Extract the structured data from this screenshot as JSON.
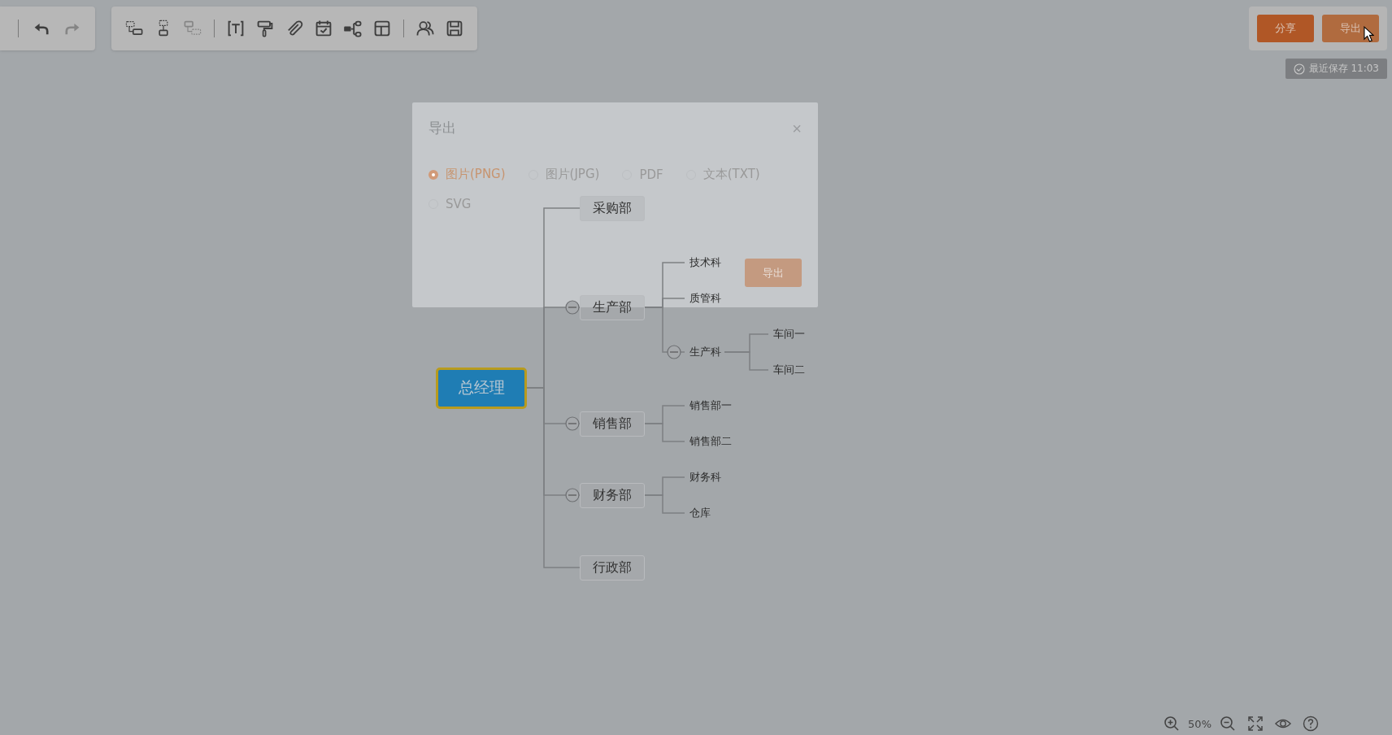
{
  "toolbars": [
    {
      "sections": [
        {
          "tools": [
            {
              "disabled": false
            },
            {
              "disabled": true
            }
          ]
        }
      ]
    },
    {
      "sections": [
        {
          "tools": [
            {
              "disabled": false
            },
            {
              "disabled": false
            },
            {
              "disabled": true
            }
          ]
        },
        {
          "tools": [
            {
              "disabled": false
            },
            {
              "disabled": false
            },
            {
              "disabled": false
            },
            {
              "disabled": false
            },
            {
              "disabled": false
            },
            {
              "disabled": false
            }
          ]
        },
        {
          "tools": [
            {
              "disabled": false
            },
            {
              "disabled": false
            }
          ]
        }
      ]
    }
  ],
  "actions": [
    {
      "label": "分享",
      "hovered": false
    },
    {
      "label": "导出",
      "hovered": true
    }
  ],
  "save_status": "最近保存 11:03",
  "mindmap": {
    "text": "总经理",
    "selected": true,
    "children": [
      {
        "text": "采购部"
      },
      {
        "text": "生产部",
        "expanded": true,
        "children": [
          {
            "text": "技术科"
          },
          {
            "text": "质管科"
          },
          {
            "text": "生产科",
            "expanded": true,
            "children": [
              {
                "text": "车间一"
              },
              {
                "text": "车间二"
              }
            ]
          }
        ]
      },
      {
        "text": "销售部",
        "expanded": true,
        "children": [
          {
            "text": "销售部一"
          },
          {
            "text": "销售部二"
          }
        ]
      },
      {
        "text": "财务部",
        "expanded": true,
        "children": [
          {
            "text": "财务科"
          },
          {
            "text": "仓库"
          }
        ]
      },
      {
        "text": "行政部"
      }
    ]
  },
  "dialog": {
    "title": "导出",
    "close": "×",
    "options": [
      {
        "label": "图片(PNG)",
        "selected": true
      },
      {
        "label": "图片(JPG)",
        "selected": false
      },
      {
        "label": "PDF",
        "selected": false
      },
      {
        "label": "文本(TXT)",
        "selected": false
      },
      {
        "label": "SVG",
        "selected": false
      }
    ],
    "button": "导出"
  },
  "zoom": {
    "level": "50%"
  }
}
